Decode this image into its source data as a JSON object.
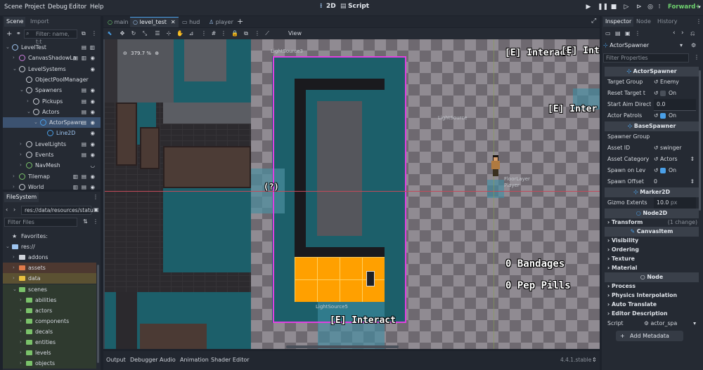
{
  "menu": [
    "Scene",
    "Project",
    "Debug",
    "Editor",
    "Help"
  ],
  "modes": {
    "2d": "2D",
    "script": "Script"
  },
  "renderer": "Forward+",
  "scene_dock": {
    "tabs": [
      "Scene",
      "Import"
    ],
    "filter_placeholder": "Filter: name, t:t",
    "tree": [
      {
        "label": "LevelTest",
        "depth": 0
      },
      {
        "label": "CanvasShadowLa",
        "depth": 1
      },
      {
        "label": "LevelSystems",
        "depth": 1
      },
      {
        "label": "ObjectPoolManager",
        "depth": 2
      },
      {
        "label": "Spawners",
        "depth": 2
      },
      {
        "label": "Pickups",
        "depth": 3
      },
      {
        "label": "Actors",
        "depth": 3
      },
      {
        "label": "ActorSpawn",
        "depth": 4
      },
      {
        "label": "Line2D",
        "depth": 5
      },
      {
        "label": "LevelLights",
        "depth": 2
      },
      {
        "label": "Events",
        "depth": 2
      },
      {
        "label": "NavMesh",
        "depth": 2
      },
      {
        "label": "Tilemap",
        "depth": 1
      },
      {
        "label": "World",
        "depth": 1
      }
    ]
  },
  "filesystem": {
    "tab": "FileSystem",
    "path": "res://data/resources/statu",
    "filter_placeholder": "Filter Files",
    "items": [
      {
        "label": "Favorites:",
        "depth": 0
      },
      {
        "label": "res://",
        "depth": 0
      },
      {
        "label": "addons",
        "depth": 1
      },
      {
        "label": "assets",
        "depth": 1
      },
      {
        "label": "data",
        "depth": 1
      },
      {
        "label": "scenes",
        "depth": 1
      },
      {
        "label": "abilities",
        "depth": 2
      },
      {
        "label": "actors",
        "depth": 2
      },
      {
        "label": "components",
        "depth": 2
      },
      {
        "label": "decals",
        "depth": 2
      },
      {
        "label": "entities",
        "depth": 2
      },
      {
        "label": "levels",
        "depth": 2
      },
      {
        "label": "objects",
        "depth": 2
      }
    ]
  },
  "editor_tabs": [
    "main",
    "level_test",
    "hud",
    "player"
  ],
  "toolbar": {
    "view_label": "View"
  },
  "zoom": "379.7 %",
  "canvas": {
    "light_labels": [
      "LightSource3",
      "LightSource",
      "LightSource5"
    ],
    "interact_top_a": "[E] Interact",
    "interact_top_b": "[E] Inte",
    "interact_mid": "[E] Inter",
    "interact_bottom": "[E] Interact",
    "question": "(?)",
    "bandages": "0 Bandages",
    "pep_pills": "0 Pep Pills",
    "floor_layer": "FloorLayer",
    "player": "Player"
  },
  "inspector": {
    "tabs": [
      "Inspector",
      "Node",
      "History"
    ],
    "node_name": "ActorSpawner",
    "filter_placeholder": "Filter Properties",
    "actor_spawner_header": "ActorSpawner",
    "target_group": {
      "label": "Target Group",
      "value": "Enemy"
    },
    "reset_target": {
      "label": "Reset Target t",
      "value": "On"
    },
    "start_aim": {
      "label": "Start Aim Directi",
      "value": "0.0"
    },
    "actor_patrols": {
      "label": "Actor Patrols",
      "value": "On"
    },
    "base_spawner_header": "BaseSpawner",
    "spawner_group": {
      "label": "Spawner Group",
      "value": ""
    },
    "asset_id": {
      "label": "Asset ID",
      "value": "swinger"
    },
    "asset_category": {
      "label": "Asset Category",
      "value": "Actors"
    },
    "spawn_on_lev": {
      "label": "Spawn on Lev",
      "value": "On"
    },
    "spawn_offset": {
      "label": "Spawn Offset",
      "value": "0"
    },
    "marker_header": "Marker2D",
    "gizmo_extents": {
      "label": "Gizmo Extents",
      "value": "10.0",
      "unit": "px"
    },
    "node2d_header": "Node2D",
    "transform": {
      "label": "Transform",
      "note": "(1 change)"
    },
    "canvasitem_header": "CanvasItem",
    "canvas_sections": [
      "Visibility",
      "Ordering",
      "Texture",
      "Material"
    ],
    "node_header": "Node",
    "node_sections": [
      "Process",
      "Physics Interpolation",
      "Auto Translate",
      "Editor Description"
    ],
    "script": {
      "label": "Script",
      "value": "actor_spa"
    },
    "add_metadata": "Add Metadata"
  },
  "bottom_tabs": [
    "Output",
    "Debugger",
    "Audio",
    "Animation",
    "Shader Editor"
  ],
  "version": "4.4.1.stable",
  "colors": {
    "accent": "#4aa0e8",
    "checked": "#4aa0e8",
    "selection_magenta": "#e040e0",
    "highlight_orange": "#ffa000",
    "teal": "#1c5f6a"
  }
}
